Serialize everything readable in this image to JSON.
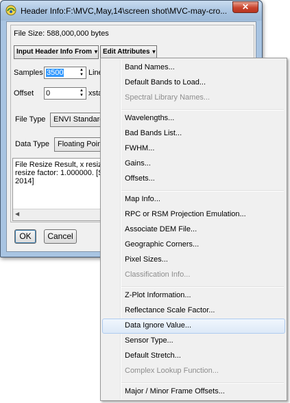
{
  "window": {
    "title": "Header Info:F:\\MVC,May,14\\screen shot\\MVC-may-cro...",
    "close_label": "✕"
  },
  "header": {
    "file_size": "File Size: 588,000,000 bytes",
    "input_header_menu": "Input Header Info From",
    "edit_attributes_menu": "Edit Attributes"
  },
  "fields": {
    "samples_label": "Samples",
    "samples_value": "3500",
    "lines_label": "Line",
    "offset_label": "Offset",
    "offset_value": "0",
    "xstart_label": "xsta",
    "file_type_label": "File Type",
    "file_type_value": "ENVI Standard",
    "data_type_label": "Data Type",
    "data_type_value": "Floating Point"
  },
  "description": {
    "line1": "File Resize Result, x resize",
    "line2": "resize factor: 1.000000. [Su",
    "line3": "2014]"
  },
  "buttons": {
    "ok": "OK",
    "cancel": "Cancel"
  },
  "menu": {
    "items": [
      {
        "label": "Band Names...",
        "enabled": true
      },
      {
        "label": "Default Bands to Load...",
        "enabled": true
      },
      {
        "label": "Spectral Library Names...",
        "enabled": false
      },
      {
        "label": "Wavelengths...",
        "enabled": true
      },
      {
        "label": "Bad Bands List...",
        "enabled": true
      },
      {
        "label": "FWHM...",
        "enabled": true
      },
      {
        "label": "Gains...",
        "enabled": true
      },
      {
        "label": "Offsets...",
        "enabled": true
      },
      {
        "label": "Map Info...",
        "enabled": true
      },
      {
        "label": "RPC or RSM Projection Emulation...",
        "enabled": true
      },
      {
        "label": "Associate DEM File...",
        "enabled": true
      },
      {
        "label": "Geographic Corners...",
        "enabled": true
      },
      {
        "label": "Pixel Sizes...",
        "enabled": true
      },
      {
        "label": "Classification Info...",
        "enabled": false
      },
      {
        "label": "Z-Plot Information...",
        "enabled": true
      },
      {
        "label": "Reflectance Scale Factor...",
        "enabled": true
      },
      {
        "label": "Data Ignore Value...",
        "enabled": true,
        "highlighted": true
      },
      {
        "label": "Sensor Type...",
        "enabled": true
      },
      {
        "label": "Default Stretch...",
        "enabled": true
      },
      {
        "label": "Complex Lookup Function...",
        "enabled": false
      },
      {
        "label": "Major / Minor Frame Offsets...",
        "enabled": true
      }
    ]
  },
  "colors": {
    "title_bar": "#a7c2df",
    "close_button": "#c9442d",
    "selection": "#3399ff",
    "menu_highlight_border": "#aecbf0"
  }
}
